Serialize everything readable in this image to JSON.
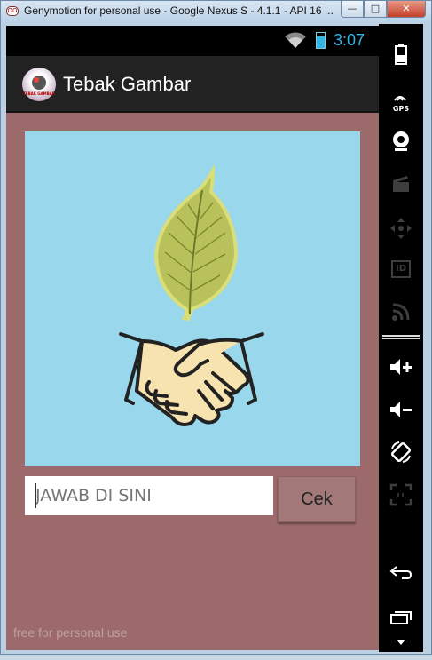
{
  "window": {
    "title": "Genymotion for personal use - Google Nexus S - 4.1.1 - API 16 ...",
    "logo_text": "OO",
    "buttons": {
      "minimize": "—",
      "maximize": "□",
      "close": "✕"
    }
  },
  "status_bar": {
    "time": "3:07"
  },
  "action_bar": {
    "title": "Tebak Gambar",
    "logo_caption": "TEBAK GAMBAR"
  },
  "puzzle": {
    "image_description_icons": [
      "leaf-icon",
      "handshake-icon"
    ]
  },
  "answer": {
    "placeholder": "JAWAB DI SINI",
    "value": ""
  },
  "check_button": {
    "label": "Cek"
  },
  "watermark": "free for personal use",
  "sidebar": {
    "gps_label": "GPS",
    "id_label": "ID",
    "tools": [
      "battery-icon",
      "gps-icon",
      "camera-icon",
      "video-icon",
      "dpad-icon",
      "id-icon",
      "rss-icon",
      "volume-up-icon",
      "volume-down-icon",
      "rotate-icon",
      "scale-icon",
      "back-icon",
      "recent-apps-icon"
    ]
  },
  "colors": {
    "screen_bg": "#9c6a6a",
    "image_bg": "#98d7ec",
    "clock": "#33b5e5",
    "button_bg": "#a27878"
  }
}
